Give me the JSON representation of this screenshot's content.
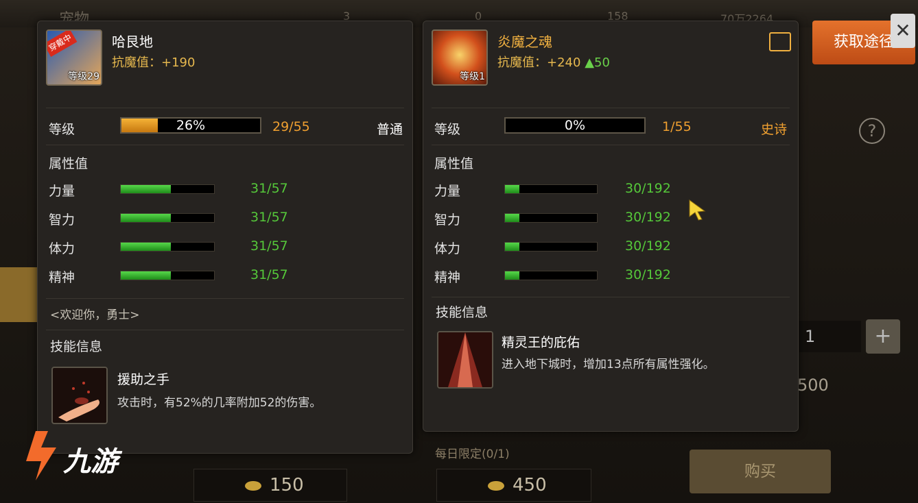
{
  "header": {
    "title": "宠物",
    "numbers": [
      "3",
      "0",
      "158",
      "70万2264"
    ]
  },
  "acquire_button": "获取途径",
  "left_card": {
    "avatar_badge": "穿戴中",
    "avatar_level": "等级29",
    "name": "哈艮地",
    "resist_label": "抗魔值：+190",
    "level_label": "等级",
    "level_percent": "26%",
    "level_progress": 0.26,
    "level_count": "29/55",
    "grade": "普通",
    "attr_title": "属性值",
    "stats": [
      {
        "label": "力量",
        "value": "31/57",
        "ratio": 0.54
      },
      {
        "label": "智力",
        "value": "31/57",
        "ratio": 0.54
      },
      {
        "label": "体力",
        "value": "31/57",
        "ratio": 0.54
      },
      {
        "label": "精神",
        "value": "31/57",
        "ratio": 0.54
      }
    ],
    "welcome": "<欢迎你，勇士>",
    "skill_title": "技能信息",
    "skill_name": "援助之手",
    "skill_desc": "攻击时，有52%的几率附加52的伤害。"
  },
  "right_card": {
    "avatar_level": "等级1",
    "name": "炎魔之魂",
    "resist_label": "抗魔值：+240",
    "resist_up": "▲50",
    "level_label": "等级",
    "level_percent": "0%",
    "level_progress": 0,
    "level_count": "1/55",
    "grade": "史诗",
    "attr_title": "属性值",
    "stats": [
      {
        "label": "力量",
        "value": "30/192",
        "ratio": 0.16
      },
      {
        "label": "智力",
        "value": "30/192",
        "ratio": 0.16
      },
      {
        "label": "体力",
        "value": "30/192",
        "ratio": 0.16
      },
      {
        "label": "精神",
        "value": "30/192",
        "ratio": 0.16
      }
    ],
    "skill_title": "技能信息",
    "skill_name": "精灵王的庇佑",
    "skill_desc": "进入地下城时，增加13点所有属性强化。"
  },
  "shop": {
    "price_left": "150",
    "price_right": "450",
    "daily_limit": "每日限定(0/1)",
    "buy_label": "购买",
    "quantity": "1",
    "plus": "+",
    "other_price": "500"
  },
  "help": "?",
  "close": "✕",
  "logo": "九游",
  "colors": {
    "accent_orange": "#e4722c",
    "stat_green": "#55c83a",
    "level_orange": "#f0a030"
  }
}
